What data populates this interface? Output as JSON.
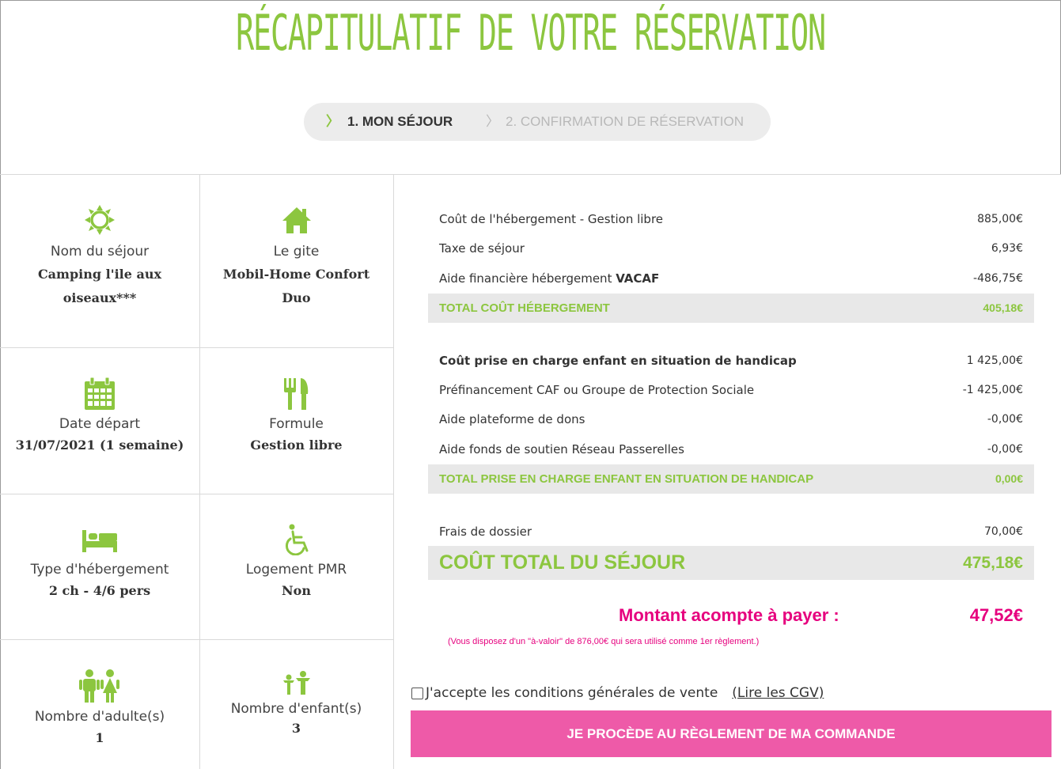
{
  "page": {
    "title": "RÉCAPITULATIF DE VOTRE RÉSERVATION",
    "accent_color": "#8cc63f",
    "pink_color": "#e6007e",
    "button_color": "#ee5aa8"
  },
  "steps": [
    {
      "label": "1. MON SÉJOUR",
      "active": true
    },
    {
      "label": "2. CONFIRMATION DE RÉSERVATION",
      "active": false
    }
  ],
  "summary": {
    "nom_sejour": {
      "label": "Nom du séjour",
      "value": "Camping l'ile aux oiseaux***",
      "icon": "sun-icon"
    },
    "gite": {
      "label": "Le gite",
      "value": "Mobil-Home Confort Duo",
      "icon": "house-icon"
    },
    "date_depart": {
      "label": "Date départ",
      "value": "31/07/2021 (1 semaine)",
      "icon": "calendar-icon"
    },
    "formule": {
      "label": "Formule",
      "value": "Gestion libre",
      "icon": "utensils-icon"
    },
    "type_hebergement": {
      "label": "Type d'hébergement",
      "value": "2 ch - 4/6 pers",
      "icon": "bed-icon"
    },
    "logement_pmr": {
      "label": "Logement PMR",
      "value": "Non",
      "icon": "wheelchair-icon"
    },
    "adultes": {
      "label": "Nombre d'adulte(s)",
      "value": "1",
      "icon": "adults-icon"
    },
    "enfants": {
      "label": "Nombre d'enfant(s)",
      "value": "3",
      "icon": "children-icon"
    }
  },
  "costs": {
    "hebergement": [
      {
        "label": "Coût de l'hébergement - Gestion libre",
        "value": "885,00€"
      },
      {
        "label": "Taxe de séjour",
        "value": "6,93€"
      },
      {
        "label": "Aide financière hébergement ",
        "label_bold": "VACAF",
        "value": "-486,75€"
      }
    ],
    "hebergement_total": {
      "label": "TOTAL COÛT HÉBERGEMENT",
      "value": "405,18€"
    },
    "handicap": [
      {
        "label": "Coût prise en charge enfant en situation de handicap",
        "value": "1 425,00€"
      },
      {
        "label": "Préfinancement CAF ou Groupe de Protection Sociale",
        "value": "-1 425,00€"
      },
      {
        "label": "Aide plateforme de dons",
        "value": "-0,00€"
      },
      {
        "label": "Aide fonds de soutien Réseau Passerelles",
        "value": "-0,00€"
      }
    ],
    "handicap_total": {
      "label": "TOTAL PRISE EN CHARGE ENFANT EN SITUATION DE HANDICAP",
      "value": "0,00€"
    },
    "frais": {
      "label": "Frais de dossier",
      "value": "70,00€"
    },
    "grand_total": {
      "label": "COÛT TOTAL DU SÉJOUR",
      "value": "475,18€"
    }
  },
  "acompte": {
    "label": "Montant acompte à payer :",
    "value": "47,52€",
    "note": "(Vous disposez d'un \"à-valoir\" de 876,00€ qui sera utilisé comme 1er règlement.)"
  },
  "cgv": {
    "label": "J'accepte les conditions générales de vente",
    "link": "(Lire les CGV)",
    "checked": false
  },
  "pay_button": {
    "label": "JE PROCÈDE AU RÈGLEMENT DE MA COMMANDE"
  }
}
